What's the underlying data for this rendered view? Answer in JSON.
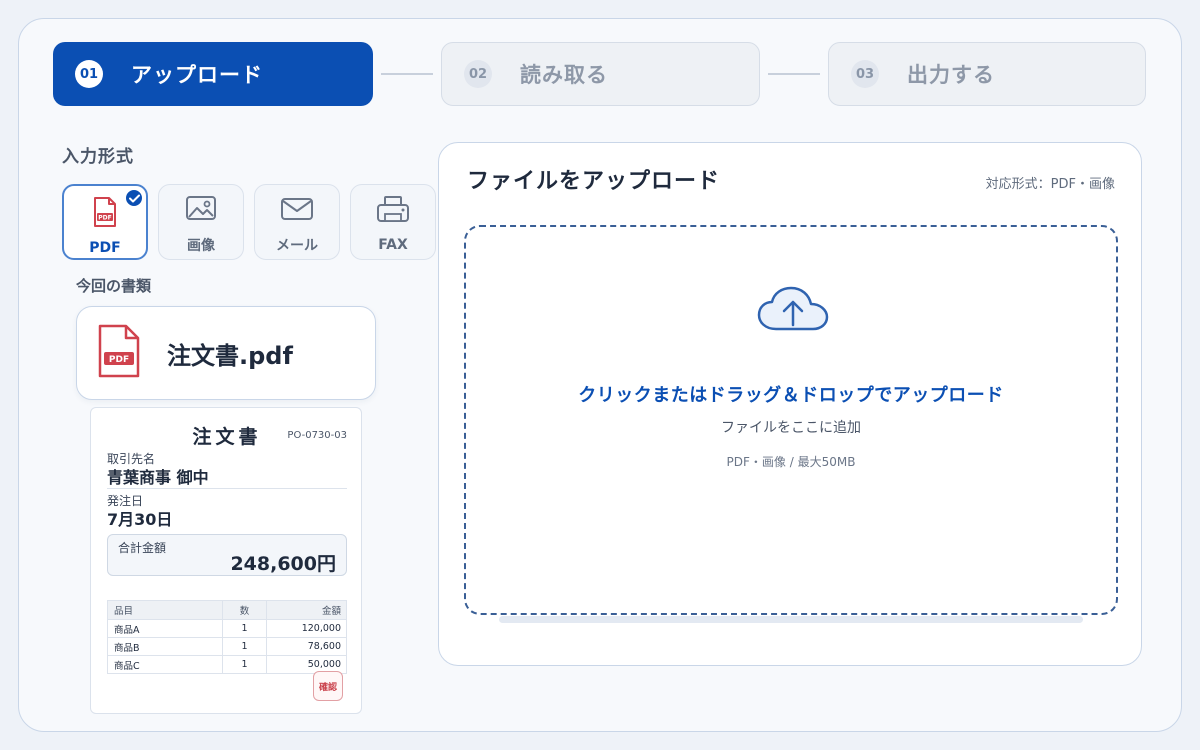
{
  "stepper": {
    "steps": [
      {
        "num": "01",
        "label": "アップロード",
        "state": "active"
      },
      {
        "num": "02",
        "label": "読み取る",
        "state": "inactive"
      },
      {
        "num": "03",
        "label": "出力する",
        "state": "inactive"
      }
    ]
  },
  "input": {
    "section_label": "入力形式",
    "formats": [
      {
        "label": "PDF",
        "icon": "pdf-file-icon",
        "selected": true
      },
      {
        "label": "画像",
        "icon": "image-icon",
        "selected": false
      },
      {
        "label": "メール",
        "icon": "mail-icon",
        "selected": false
      },
      {
        "label": "FAX",
        "icon": "fax-icon",
        "selected": false
      }
    ],
    "current_doc_label": "今回の書類",
    "file_name": "注文書.pdf",
    "file_icon_text": "PDF"
  },
  "document": {
    "title": "注文書",
    "number": "PO-0730-03",
    "client_label": "取引先名",
    "client_value": "青葉商事 御中",
    "date_label": "発注日",
    "date_value": "7月30日",
    "total_label": "合計金額",
    "total_value": "248,600円",
    "table": {
      "headers": [
        "品目",
        "数",
        "金額"
      ],
      "rows": [
        [
          "商品A",
          "1",
          "120,000"
        ],
        [
          "商品B",
          "1",
          "78,600"
        ],
        [
          "商品C",
          "1",
          "50,000"
        ]
      ]
    },
    "stamp": "確認"
  },
  "upload": {
    "title": "ファイルをアップロード",
    "supported": "対応形式：PDF・画像",
    "drop_main": "クリックまたはドラッグ＆ドロップでアップロード",
    "drop_sub": "ファイルをここに追加",
    "drop_limit": "PDF・画像 / 最大50MB"
  },
  "colors": {
    "accent": "#0b4fb3",
    "pdf_red": "#d0424d",
    "background": "#eef2f8"
  }
}
